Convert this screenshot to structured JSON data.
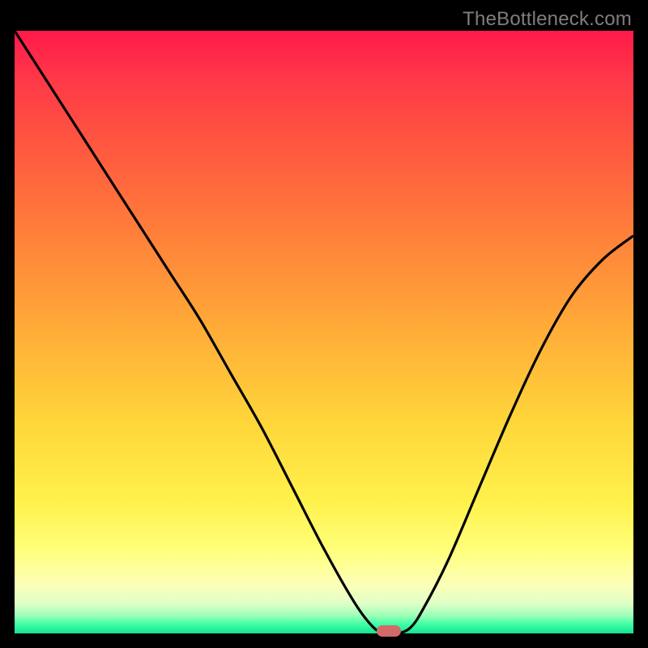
{
  "domain": "Chart",
  "watermark": "TheBottleneck.com",
  "colors": {
    "frame_border": "#000000",
    "curve_stroke": "#000000",
    "marker_fill": "#d36a67"
  },
  "chart_data": {
    "type": "line",
    "title": "",
    "xlabel": "",
    "ylabel": "",
    "xlim": [
      0,
      100
    ],
    "ylim": [
      0,
      100
    ],
    "grid": false,
    "series": [
      {
        "name": "bottleneck-curve",
        "x": [
          0,
          5,
          10,
          15,
          20,
          25,
          30,
          35,
          40,
          45,
          50,
          55,
          58,
          60,
          62,
          64,
          66,
          70,
          75,
          80,
          85,
          90,
          95,
          100
        ],
        "y": [
          100,
          92,
          84,
          76,
          68,
          60,
          52,
          43,
          34,
          24,
          14,
          5,
          1,
          0,
          0,
          1,
          4,
          12,
          24,
          36,
          47,
          56,
          62,
          66
        ]
      }
    ],
    "marker": {
      "name": "optimal-point",
      "x": 60.5,
      "y": 0
    },
    "gradient_meaning": "red=high bottleneck, green=low bottleneck"
  }
}
